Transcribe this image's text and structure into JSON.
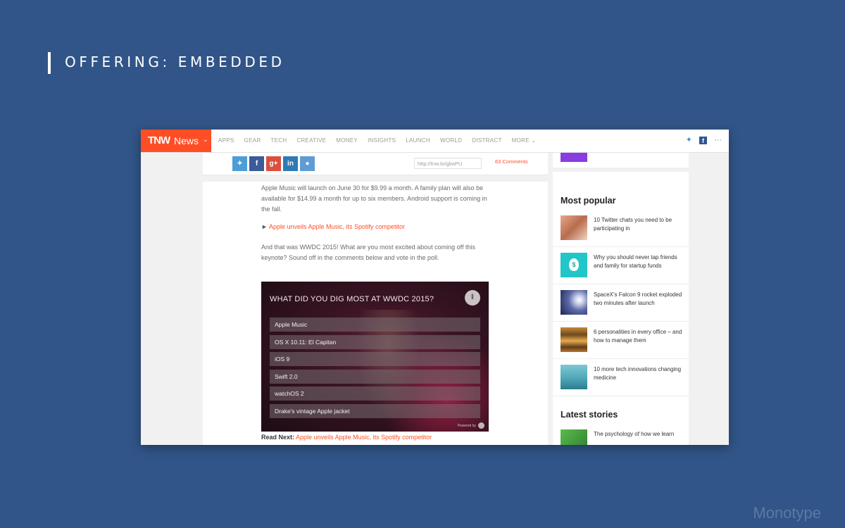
{
  "slide": {
    "title": "OFFERING: EMBEDDED",
    "brand": "Monotype"
  },
  "browser": {
    "nav": {
      "logo_tnw": "TNW",
      "logo_news": "News",
      "logo_chevron": "⌄",
      "links": [
        "APPS",
        "GEAR",
        "TECH",
        "CREATIVE",
        "MONEY",
        "INSIGHTS",
        "LAUNCH",
        "WORLD",
        "DISTRACT",
        "MORE ⌄"
      ],
      "icons": [
        "twitter-icon",
        "facebook-icon",
        "more-icon"
      ]
    },
    "share": {
      "buttons": [
        "twitter",
        "facebook",
        "google-plus",
        "linkedin",
        "reddit"
      ],
      "shortlink": "http://tnw.to/gbaPU",
      "comments": "63 Comments"
    },
    "article": {
      "p1": "Apple Music will launch on June 30 for $9.99 a month. A family plan will also be available for $14.99 a month for up to six members. Android support is coming in the fall.",
      "p2_arrow": "►",
      "p2_link": "Apple unveils Apple Music, its Spotify competitor",
      "p3": "And that was WWDC 2015! What are you most excited about coming off this keynote? Sound off in the comments below and vote in the poll.",
      "poll": {
        "question": "WHAT DID YOU DIG MOST AT WWDC 2015?",
        "options": [
          "Apple Music",
          "OS X 10.11: El Capitan",
          "iOS 9",
          "Swift 2.0",
          "watchOS 2",
          "Drake's vintage Apple jacket"
        ],
        "powered": "Powered by"
      },
      "read_next_label": "Read Next:",
      "read_next_link": "Apple unveils Apple Music, its Spotify competitor"
    },
    "sidebar": {
      "most_popular_title": "Most popular",
      "most_popular": [
        "10 Twitter chats you need to be participating in",
        "Why you should never tap friends and family for startup funds",
        "SpaceX's Falcon 9 rocket exploded two minutes after launch",
        "6 personalities in every office – and how to manage them",
        "10 more tech innovations changing medicine"
      ],
      "latest_title": "Latest stories",
      "latest": [
        "The psychology of how we learn"
      ]
    }
  },
  "colors": {
    "background": "#315588",
    "accent": "#ff4e25"
  }
}
